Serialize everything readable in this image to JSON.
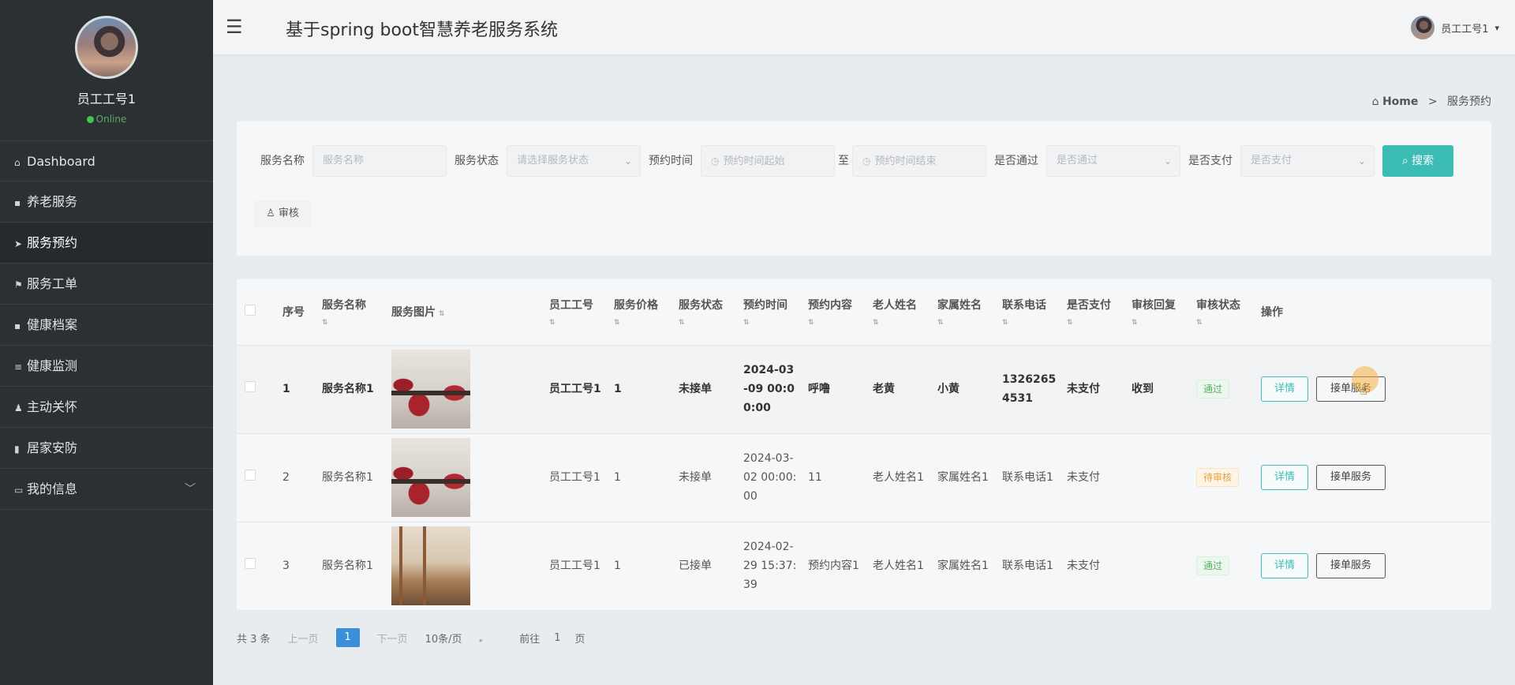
{
  "sidebar": {
    "user_name": "员工工号1",
    "user_status": "Online",
    "items": [
      {
        "label": "Dashboard",
        "icon": "home-icon"
      },
      {
        "label": "养老服务",
        "icon": "database-icon"
      },
      {
        "label": "服务预约",
        "icon": "send-icon"
      },
      {
        "label": "服务工单",
        "icon": "flag-icon"
      },
      {
        "label": "健康档案",
        "icon": "comment-icon"
      },
      {
        "label": "健康监测",
        "icon": "list-icon"
      },
      {
        "label": "主动关怀",
        "icon": "user-icon"
      },
      {
        "label": "居家安防",
        "icon": "bar-chart-icon"
      },
      {
        "label": "我的信息",
        "icon": "profile-card-icon"
      }
    ],
    "active_item": "服务预约"
  },
  "header": {
    "title": "基于spring boot智慧养老服务系统",
    "user_name": "员工工号1"
  },
  "breadcrumb": {
    "home": "Home",
    "current": "服务预约"
  },
  "search": {
    "service_name_label": "服务名称",
    "service_name_placeholder": "服务名称",
    "service_status_label": "服务状态",
    "service_status_placeholder": "请选择服务状态",
    "booking_time_label": "预约时间",
    "time_start_placeholder": "预约时间起始",
    "to_label": "至",
    "time_end_placeholder": "预约时间结束",
    "approved_label": "是否通过",
    "approved_placeholder": "是否通过",
    "paid_label": "是否支付",
    "paid_placeholder": "是否支付",
    "search_button": "搜索",
    "audit_button": "审核"
  },
  "table": {
    "headers": {
      "index": "序号",
      "service_name": "服务名称",
      "service_image": "服务图片",
      "staff_no": "员工工号",
      "price": "服务价格",
      "status": "服务状态",
      "booking_time": "预约时间",
      "content": "预约内容",
      "elder_name": "老人姓名",
      "family_name": "家属姓名",
      "phone": "联系电话",
      "paid": "是否支付",
      "reply": "审核回复",
      "audit_status": "审核状态",
      "actions": "操作"
    },
    "rows": [
      {
        "index": "1",
        "service_name": "服务名称1",
        "staff_no": "员工工号1",
        "price": "1",
        "status": "未接单",
        "booking_time": "2024-03-09 00:00:00",
        "content": "呼噜",
        "elder_name": "老黄",
        "family_name": "小黄",
        "phone": "13262654531",
        "paid": "未支付",
        "reply": "收到",
        "audit_status": "通过",
        "audit_type": "pass",
        "image": "room"
      },
      {
        "index": "2",
        "service_name": "服务名称1",
        "staff_no": "员工工号1",
        "price": "1",
        "status": "未接单",
        "booking_time": "2024-03-02 00:00:00",
        "content": "11",
        "elder_name": "老人姓名1",
        "family_name": "家属姓名1",
        "phone": "联系电话1",
        "paid": "未支付",
        "reply": "",
        "audit_status": "待审核",
        "audit_type": "pending",
        "image": "room"
      },
      {
        "index": "3",
        "service_name": "服务名称1",
        "staff_no": "员工工号1",
        "price": "1",
        "status": "已接单",
        "booking_time": "2024-02-29 15:37:39",
        "content": "预约内容1",
        "elder_name": "老人姓名1",
        "family_name": "家属姓名1",
        "phone": "联系电话1",
        "paid": "未支付",
        "reply": "",
        "audit_status": "通过",
        "audit_type": "pass",
        "image": "dorm"
      }
    ],
    "detail_button": "详情",
    "accept_button": "接单服务"
  },
  "pagination": {
    "total": "共 3 条",
    "prev": "上一页",
    "current": "1",
    "next": "下一页",
    "page_size": "10条/页",
    "goto_label": "前往",
    "goto_value": "1",
    "page_suffix": "页"
  }
}
